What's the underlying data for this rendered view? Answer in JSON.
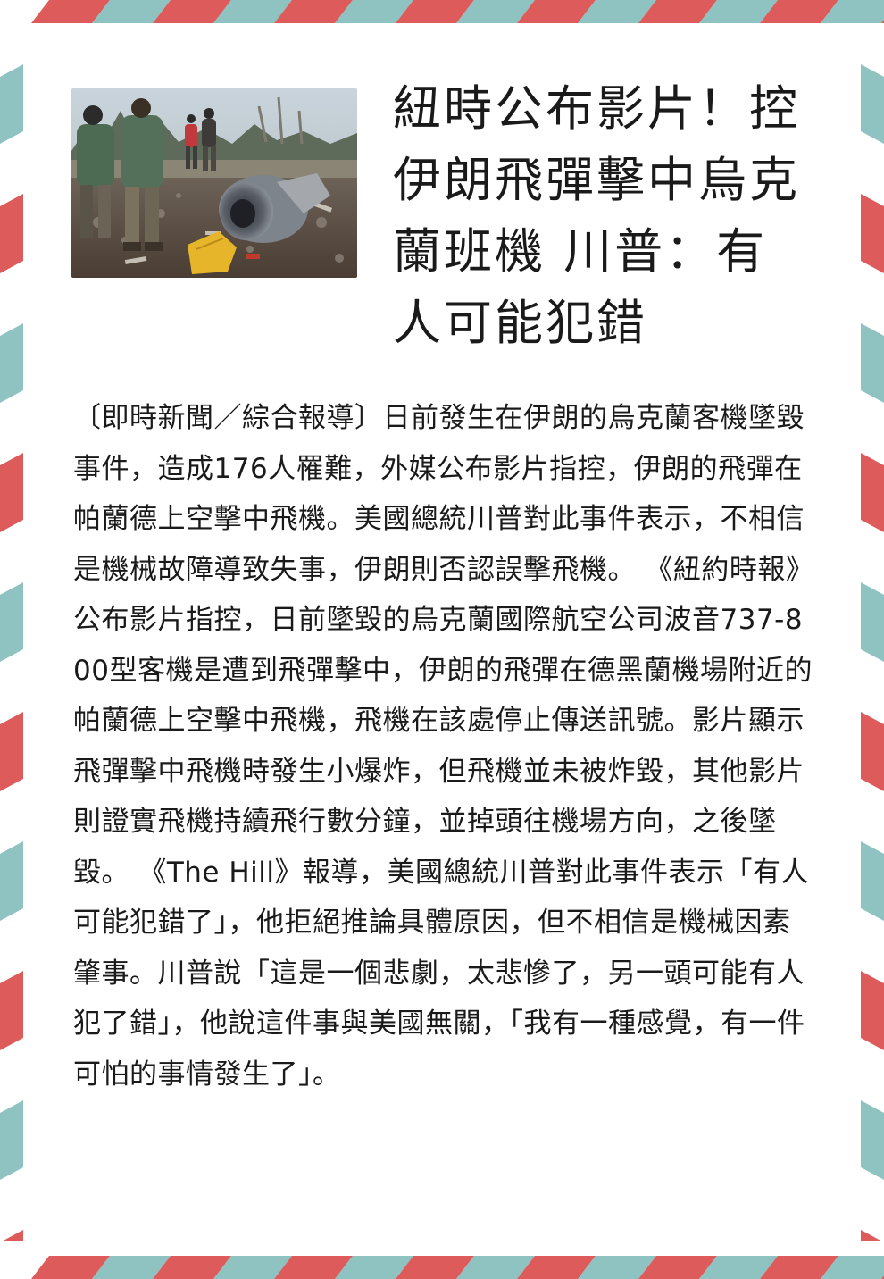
{
  "article": {
    "headline": "紐時公布影片！控伊朗飛彈擊中烏克蘭班機 川普：有人可能犯錯",
    "body": "〔即時新聞／綜合報導〕日前發生在伊朗的烏克蘭客機墜毀事件，造成176人罹難，外媒公布影片指控，伊朗的飛彈在帕蘭德上空擊中飛機。美國總統川普對此事件表示，不相信是機械故障導致失事，伊朗則否認誤擊飛機。 《紐約時報》公布影片指控，日前墜毀的烏克蘭國際航空公司波音737-800型客機是遭到飛彈擊中，伊朗的飛彈在德黑蘭機場附近的帕蘭德上空擊中飛機，飛機在該處停止傳送訊號。影片顯示飛彈擊中飛機時發生小爆炸，但飛機並未被炸毀，其他影片則證實飛機持續飛行數分鐘，並掉頭往機場方向，之後墜毀。 《The Hill》報導，美國總統川普對此事件表示「有人可能犯錯了」，他拒絕推論具體原因，但不相信是機械因素肇事。川普說「這是一個悲劇，太悲慘了，另一頭可能有人犯了錯」，他說這件事與美國無關，「我有一種感覺，有一件可怕的事情發生了」。"
  },
  "colors": {
    "stripe_red": "#dd5b5b",
    "stripe_teal": "#8ec3c2",
    "text": "#1a1a1a"
  }
}
